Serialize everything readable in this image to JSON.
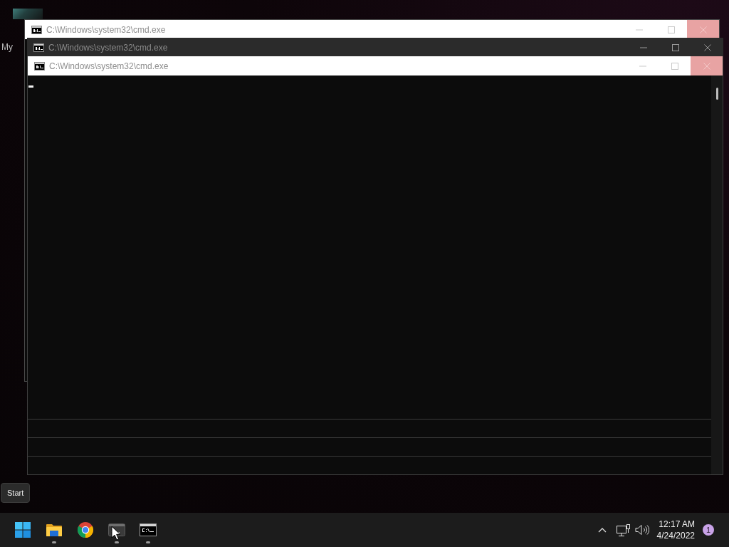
{
  "desktop": {
    "icons": [
      {
        "label": "My"
      }
    ]
  },
  "windows": [
    {
      "title": "C:\\Windows\\system32\\cmd.exe",
      "kind": "light",
      "close_highlighted": true
    },
    {
      "title": "C:\\Windows\\system32\\cmd.exe",
      "kind": "dark",
      "close_highlighted": false
    },
    {
      "title": "C:\\Windows\\system32\\cmd.exe",
      "kind": "light",
      "close_highlighted": true
    }
  ],
  "tooltip": {
    "text": "Start"
  },
  "taskbar": {
    "apps": [
      {
        "kind": "start",
        "running": false
      },
      {
        "kind": "folder",
        "running": true
      },
      {
        "kind": "browser",
        "running": false
      },
      {
        "kind": "terminal",
        "running": true
      },
      {
        "kind": "console",
        "running": true
      }
    ],
    "tray": {
      "clock": {
        "time": "12:17 AM",
        "date": "4/24/2022"
      },
      "notifications": {
        "count": "1"
      }
    }
  }
}
